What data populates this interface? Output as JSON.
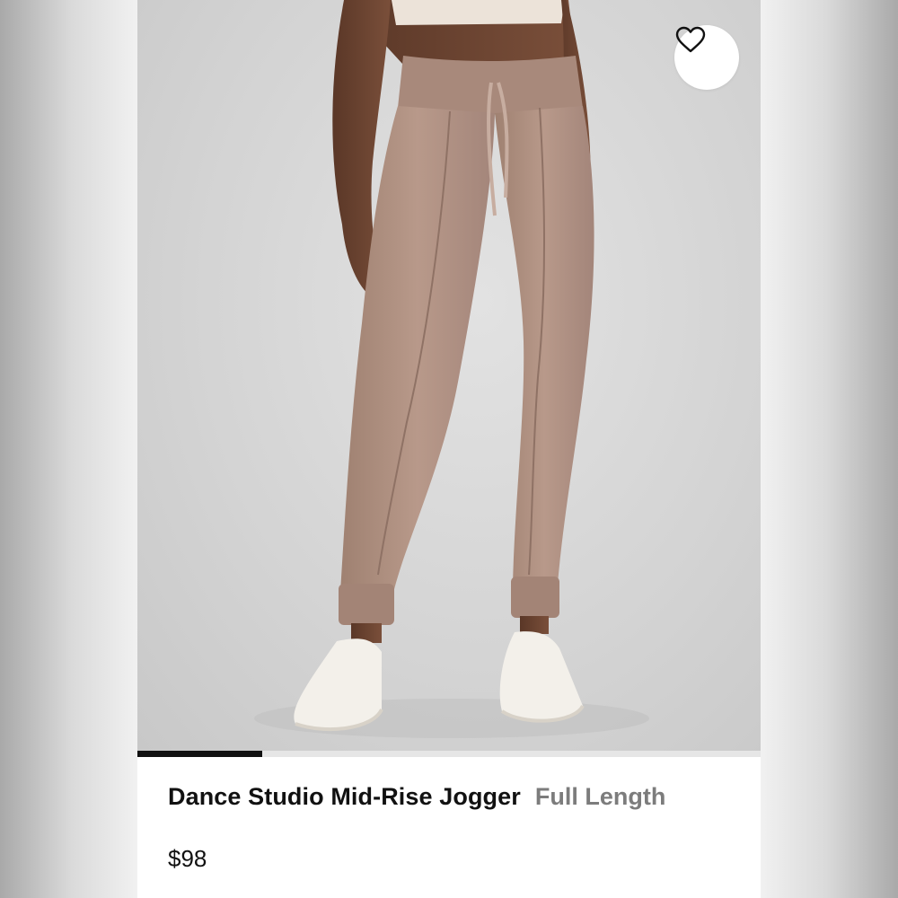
{
  "product": {
    "name": "Dance Studio Mid-Rise Jogger",
    "length": "Full Length",
    "price": "$98"
  },
  "gallery": {
    "image_subject": "model-wearing-jogger-pants",
    "progress_fraction": 0.2
  },
  "favorite": {
    "icon": "heart-outline-icon",
    "active": false
  },
  "colors": {
    "pants": "#b09383",
    "background": "#d6d6d6",
    "skin": "#6e4633",
    "sneakers": "#f2efe9",
    "progress": "#111111",
    "secondary_text": "#7c7c7c"
  }
}
